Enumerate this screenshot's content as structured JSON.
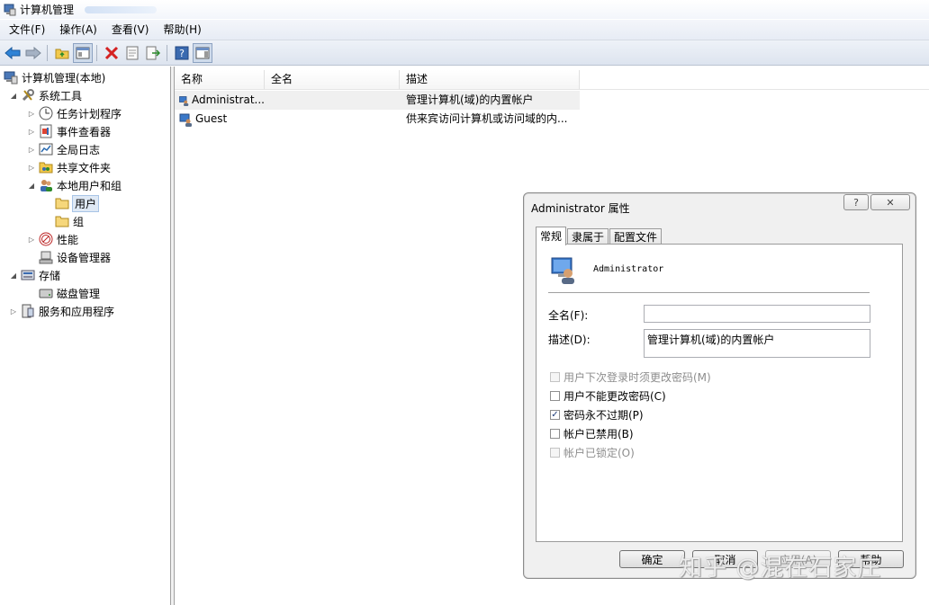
{
  "window": {
    "title": "计算机管理"
  },
  "menu": [
    "文件(F)",
    "操作(A)",
    "查看(V)",
    "帮助(H)"
  ],
  "toolbar": {
    "icons": [
      "back-arrow-icon",
      "forward-arrow-icon",
      "up-folder-icon",
      "show-hide-tree-icon",
      "delete-icon",
      "properties-icon",
      "export-list-icon",
      "help-icon",
      "show-hide-action-pane-icon"
    ]
  },
  "tree": {
    "root": "计算机管理(本地)",
    "system_tools": "系统工具",
    "task_scheduler": "任务计划程序",
    "event_viewer": "事件查看器",
    "global_log": "全局日志",
    "shared_folders": "共享文件夹",
    "local_users_groups": "本地用户和组",
    "users": "用户",
    "groups": "组",
    "performance": "性能",
    "device_manager": "设备管理器",
    "storage": "存储",
    "disk_management": "磁盘管理",
    "services_apps": "服务和应用程序"
  },
  "list": {
    "columns": [
      "名称",
      "全名",
      "描述"
    ],
    "rows": [
      {
        "name": "Administrat...",
        "full_name": "",
        "description": "管理计算机(域)的内置帐户"
      },
      {
        "name": "Guest",
        "full_name": "",
        "description": "供来宾访问计算机或访问域的内..."
      }
    ]
  },
  "dialog": {
    "title": "Administrator 属性",
    "help_btn": "?",
    "close_btn": "✕",
    "tabs": [
      "常规",
      "隶属于",
      "配置文件"
    ],
    "username": "Administrator",
    "fullname_label": "全名(F):",
    "fullname_value": "",
    "desc_label": "描述(D):",
    "desc_value": "管理计算机(域)的内置帐户",
    "checkboxes": [
      {
        "label": "用户下次登录时须更改密码(M)",
        "checked": false,
        "enabled": false
      },
      {
        "label": "用户不能更改密码(C)",
        "checked": false,
        "enabled": true
      },
      {
        "label": "密码永不过期(P)",
        "checked": true,
        "enabled": true
      },
      {
        "label": "帐户已禁用(B)",
        "checked": false,
        "enabled": true
      },
      {
        "label": "帐户已锁定(O)",
        "checked": false,
        "enabled": false
      }
    ],
    "buttons": {
      "ok": "确定",
      "cancel": "取消",
      "apply": "应用(A)",
      "help": "帮助"
    }
  },
  "watermark": "知乎 @混在石家庄"
}
